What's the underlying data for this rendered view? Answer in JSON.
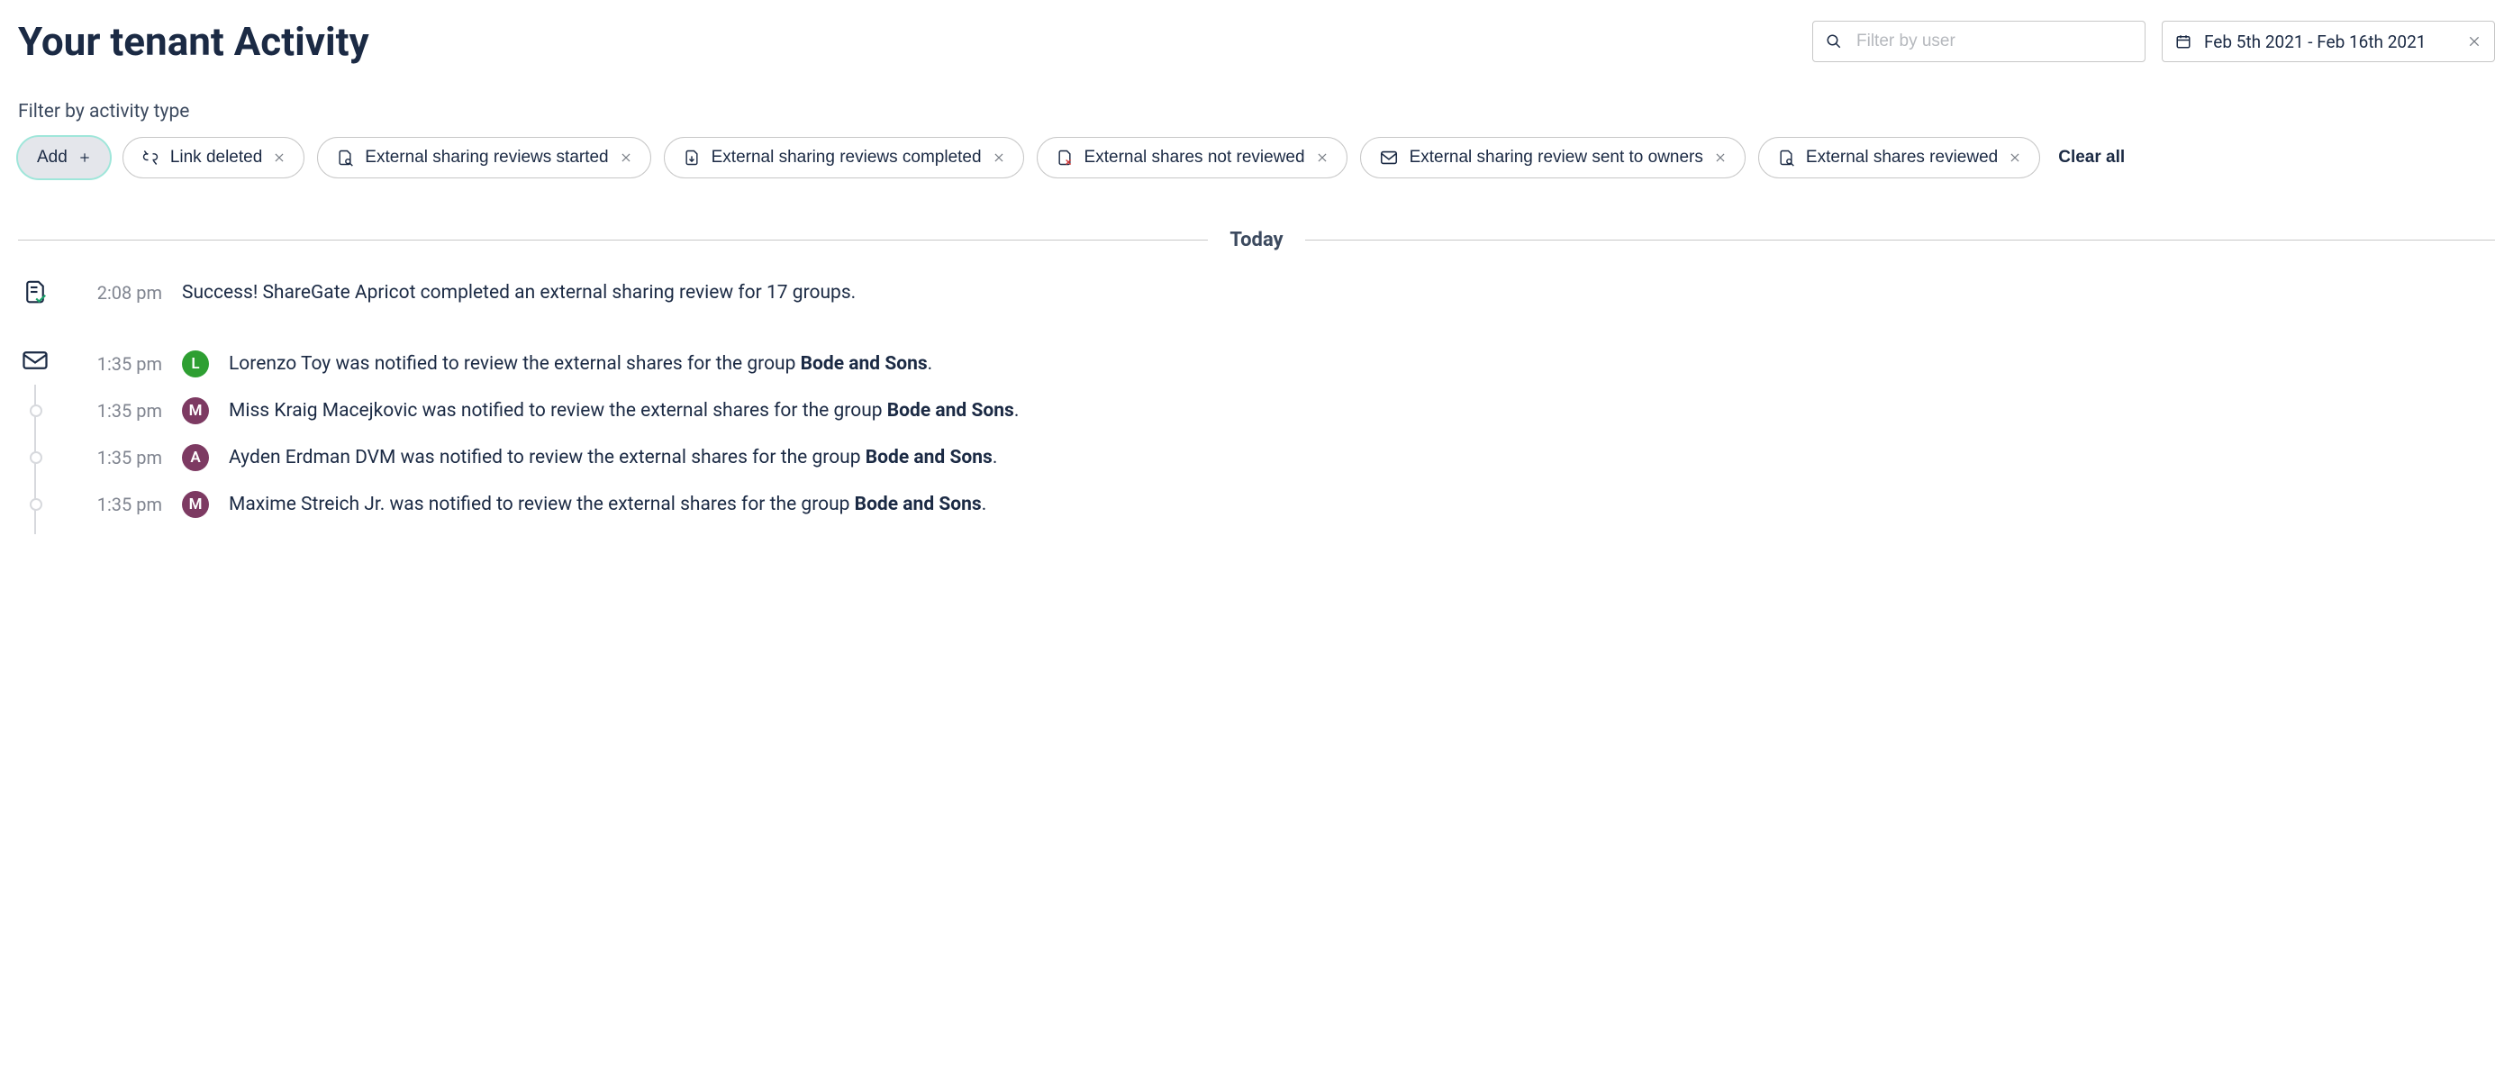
{
  "header": {
    "title": "Your tenant Activity",
    "user_filter_placeholder": "Filter by user",
    "date_range": "Feb 5th 2021 - Feb 16th 2021"
  },
  "filters": {
    "section_label": "Filter by activity type",
    "add_label": "Add",
    "clear_all": "Clear all",
    "chips": [
      {
        "label": "Link deleted",
        "icon": "link-broken"
      },
      {
        "label": "External sharing reviews started",
        "icon": "doc-search"
      },
      {
        "label": "External sharing reviews completed",
        "icon": "doc-arrow"
      },
      {
        "label": "External shares not reviewed",
        "icon": "doc-x"
      },
      {
        "label": "External sharing review sent to owners",
        "icon": "envelope"
      },
      {
        "label": "External shares reviewed",
        "icon": "doc-search"
      }
    ]
  },
  "timeline": {
    "day_label": "Today",
    "groups": [
      {
        "category_icon": "doc-check",
        "rows": [
          {
            "time": "2:08 pm",
            "avatar": null,
            "text_plain": "Success! ShareGate Apricot completed an external sharing review for 17 groups."
          }
        ]
      },
      {
        "category_icon": "envelope",
        "rows": [
          {
            "time": "1:35 pm",
            "avatar": {
              "initial": "L",
              "color": "green"
            },
            "prefix": "Lorenzo Toy was notified to review the external shares for the group ",
            "bold": "Bode and Sons",
            "suffix": "."
          },
          {
            "time": "1:35 pm",
            "avatar": {
              "initial": "M",
              "color": "purple"
            },
            "prefix": "Miss Kraig Macejkovic was notified to review the external shares for the group ",
            "bold": "Bode and Sons",
            "suffix": "."
          },
          {
            "time": "1:35 pm",
            "avatar": {
              "initial": "A",
              "color": "purple"
            },
            "prefix": "Ayden Erdman DVM was notified to review the external shares for the group ",
            "bold": "Bode and Sons",
            "suffix": "."
          },
          {
            "time": "1:35 pm",
            "avatar": {
              "initial": "M",
              "color": "purple"
            },
            "prefix": "Maxime Streich Jr. was notified to review the external shares for the group ",
            "bold": "Bode and Sons",
            "suffix": "."
          }
        ]
      }
    ]
  }
}
